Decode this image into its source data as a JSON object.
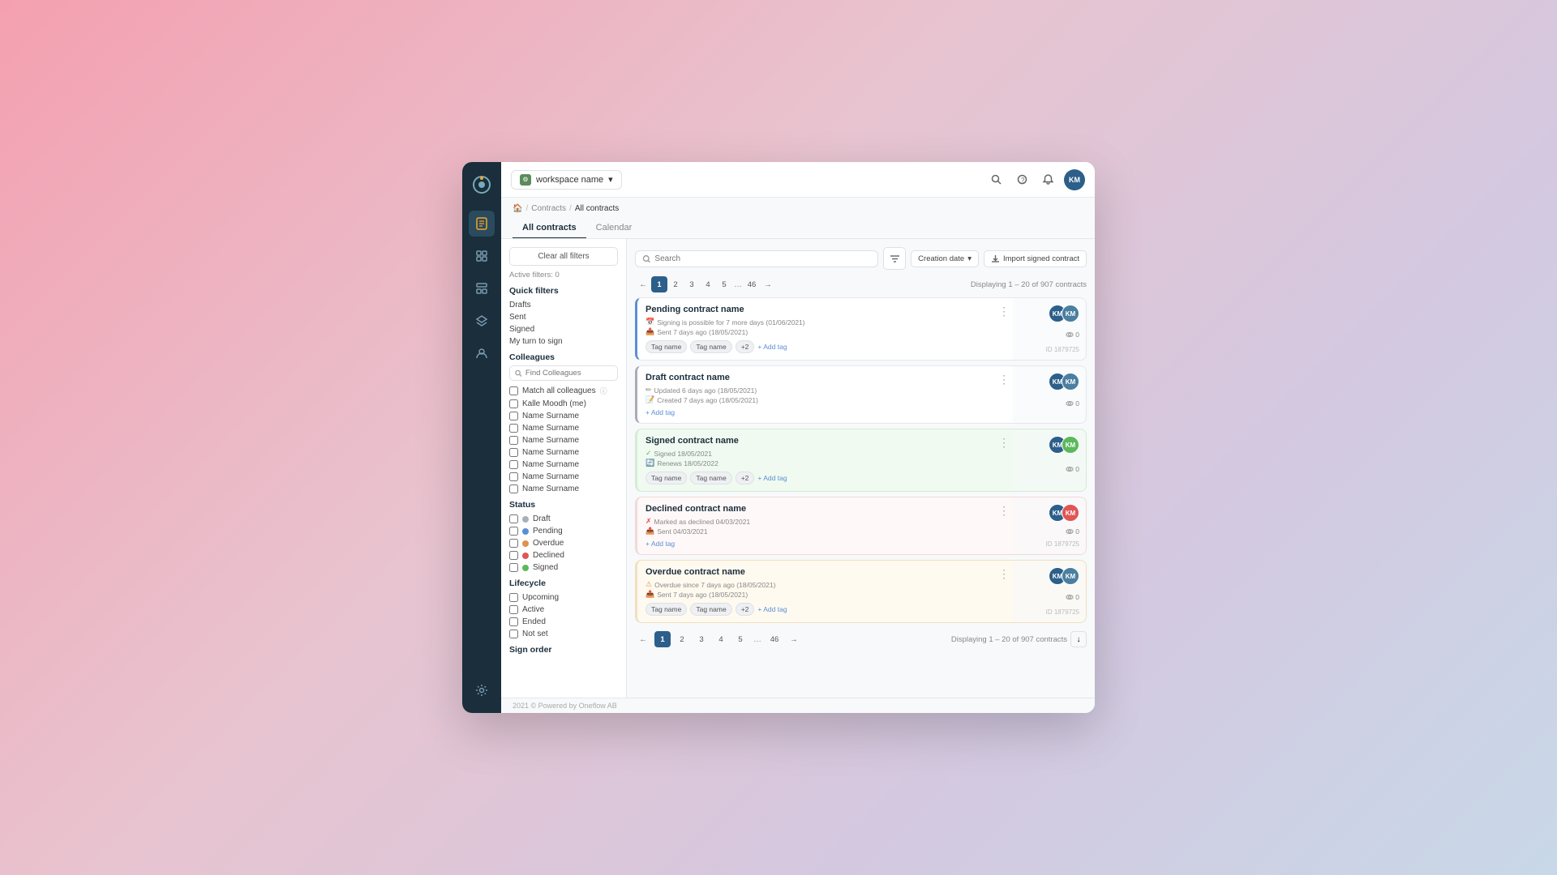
{
  "app": {
    "logo_text": "O",
    "footer": "2021 © Powered by Oneflow AB"
  },
  "workspace": {
    "label": "workspace name",
    "icon": "⚙"
  },
  "topbar": {
    "search_icon": "🔍",
    "help_icon": "?",
    "notif_icon": "🔔",
    "avatar": "KM"
  },
  "breadcrumb": {
    "home": "🏠",
    "contracts": "Contracts",
    "current": "All contracts"
  },
  "tabs": [
    {
      "id": "all",
      "label": "All contracts",
      "active": true
    },
    {
      "id": "calendar",
      "label": "Calendar",
      "active": false
    }
  ],
  "filters": {
    "clear_label": "Clear all filters",
    "active_label": "Active filters: 0",
    "quick_filters_title": "Quick filters",
    "quick_items": [
      "Drafts",
      "Sent",
      "Signed",
      "My turn to sign"
    ],
    "colleagues_title": "Colleagues",
    "colleagues_placeholder": "Find Colleagues",
    "match_all_label": "Match all colleagues",
    "colleague_items": [
      "Kalle Moodh (me)",
      "Name Surname",
      "Name Surname",
      "Name Surname",
      "Name Surname",
      "Name Surname",
      "Name Surname",
      "Name Surname"
    ],
    "status_title": "Status",
    "status_items": [
      {
        "label": "Draft",
        "color": "#aab0bb"
      },
      {
        "label": "Pending",
        "color": "#5b8fd4"
      },
      {
        "label": "Overdue",
        "color": "#e09050"
      },
      {
        "label": "Declined",
        "color": "#e05555"
      },
      {
        "label": "Signed",
        "color": "#5cb85c"
      }
    ],
    "lifecycle_title": "Lifecycle",
    "lifecycle_items": [
      "Upcoming",
      "Active",
      "Ended",
      "Not set"
    ],
    "sign_order_title": "Sign order"
  },
  "toolbar": {
    "search_placeholder": "Search",
    "sort_label": "Creation date",
    "import_label": "Import signed contract"
  },
  "pagination": {
    "pages": [
      "1",
      "2",
      "3",
      "4",
      "5",
      "...",
      "46"
    ],
    "info": "Displaying 1 – 20 of 907 contracts"
  },
  "contracts": [
    {
      "id": "pending",
      "title": "Pending contract name",
      "status": "pending",
      "meta": [
        "Signing is possible for 7 more days (01/06/2021)",
        "Sent 7 days ago (18/05/2021)"
      ],
      "meta_icons": [
        "📅",
        "📤"
      ],
      "tags": [
        "Tag name",
        "Tag name",
        "+2"
      ],
      "avatars": [
        "KM",
        "KM"
      ],
      "avatar_colors": [
        "#2c5f8a",
        "#4a7fa0"
      ],
      "views": "0",
      "card_id": "ID 1879725"
    },
    {
      "id": "draft",
      "title": "Draft contract name",
      "status": "draft",
      "meta": [
        "Updated 6 days ago (18/05/2021)",
        "Created 7 days ago (18/05/2021)"
      ],
      "meta_icons": [
        "✏️",
        "📝"
      ],
      "tags": [],
      "add_tag_only": true,
      "avatars": [
        "KM",
        "KM"
      ],
      "avatar_colors": [
        "#2c5f8a",
        "#4a7fa0"
      ],
      "views": "0",
      "card_id": ""
    },
    {
      "id": "signed",
      "title": "Signed contract name",
      "status": "signed",
      "meta": [
        "Signed 18/05/2021",
        "Renews 18/05/2022"
      ],
      "meta_icons": [
        "✓",
        "🔄"
      ],
      "tags": [
        "Tag name",
        "Tag name",
        "+2"
      ],
      "avatars": [
        "KM",
        "KM"
      ],
      "avatar_colors": [
        "#2c5f8a",
        "#5cb85c"
      ],
      "views": "0",
      "card_id": ""
    },
    {
      "id": "declined",
      "title": "Declined contract name",
      "status": "declined",
      "meta": [
        "Marked as declined 04/03/2021",
        "Sent 04/03/2021"
      ],
      "meta_icons": [
        "✗",
        "📤"
      ],
      "tags": [],
      "add_tag_only": true,
      "avatars": [
        "KM",
        "KM"
      ],
      "avatar_colors": [
        "#2c5f8a",
        "#e05555"
      ],
      "views": "0",
      "card_id": "ID 1879725"
    },
    {
      "id": "overdue",
      "title": "Overdue contract name",
      "status": "overdue",
      "meta": [
        "Overdue since 7 days ago (18/05/2021)",
        "Sent 7 days ago (18/05/2021)"
      ],
      "meta_icons": [
        "⚠",
        "📤"
      ],
      "tags": [
        "Tag name",
        "Tag name",
        "+2"
      ],
      "avatars": [
        "KM",
        "KM"
      ],
      "avatar_colors": [
        "#2c5f8a",
        "#4a7fa0"
      ],
      "views": "0",
      "card_id": "ID 1879725"
    }
  ]
}
